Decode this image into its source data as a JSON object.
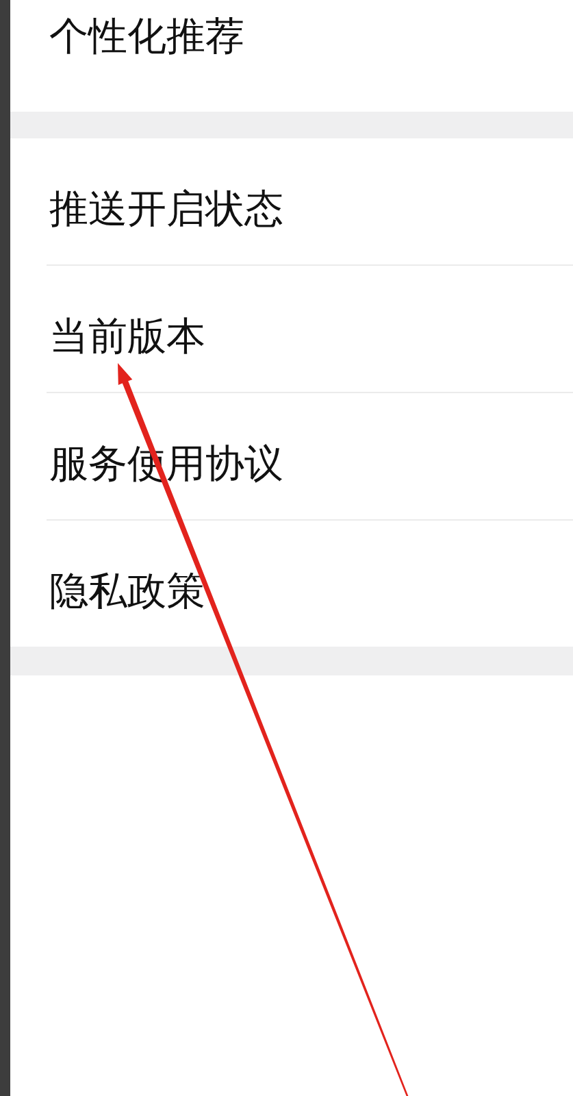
{
  "sections": [
    {
      "items": [
        {
          "label": "个性化推荐"
        }
      ]
    },
    {
      "items": [
        {
          "label": "推送开启状态"
        },
        {
          "label": "当前版本"
        },
        {
          "label": "服务使用协议"
        },
        {
          "label": "隐私政策"
        }
      ]
    }
  ]
}
